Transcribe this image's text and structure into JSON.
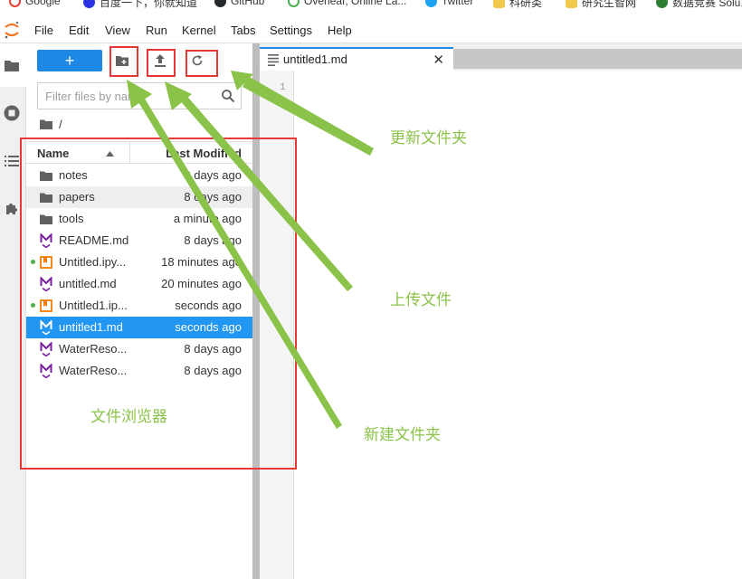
{
  "bookmarks": [
    {
      "label": "Google",
      "color": "#ea4335"
    },
    {
      "label": "百度一下，你就知道",
      "color": "#2932e1"
    },
    {
      "label": "GitHub",
      "color": "#24292e"
    },
    {
      "label": "Overleaf, Online La...",
      "color": "#4caf50"
    },
    {
      "label": "Twitter",
      "color": "#1da1f2"
    },
    {
      "label": "科研类",
      "color": "#f2c94c"
    },
    {
      "label": "研究生智网",
      "color": "#f2c94c"
    },
    {
      "label": "数据竞赛 Solu...",
      "color": "#2e7d32"
    }
  ],
  "menu": [
    "File",
    "Edit",
    "View",
    "Run",
    "Kernel",
    "Tabs",
    "Settings",
    "Help"
  ],
  "filebrowser": {
    "new_label": "+",
    "filter_placeholder": "Filter files by name",
    "breadcrumb": "/",
    "col_name": "Name",
    "col_modified": "Last Modified",
    "files": [
      {
        "name": "notes",
        "modified": "8 days ago",
        "type": "folder",
        "state": "",
        "running": false
      },
      {
        "name": "papers",
        "modified": "8 days ago",
        "type": "folder",
        "state": "hover",
        "running": false
      },
      {
        "name": "tools",
        "modified": "a minute ago",
        "type": "folder",
        "state": "",
        "running": false
      },
      {
        "name": "README.md",
        "modified": "8 days ago",
        "type": "markdown",
        "state": "",
        "running": false
      },
      {
        "name": "Untitled.ipy...",
        "modified": "18 minutes ago",
        "type": "notebook",
        "state": "",
        "running": true
      },
      {
        "name": "untitled.md",
        "modified": "20 minutes ago",
        "type": "markdown",
        "state": "",
        "running": false
      },
      {
        "name": "Untitled1.ip...",
        "modified": "seconds ago",
        "type": "notebook",
        "state": "",
        "running": true
      },
      {
        "name": "untitled1.md",
        "modified": "seconds ago",
        "type": "markdown",
        "state": "selected",
        "running": false
      },
      {
        "name": "WaterReso...",
        "modified": "8 days ago",
        "type": "markdown",
        "state": "",
        "running": false
      },
      {
        "name": "WaterReso...",
        "modified": "8 days ago",
        "type": "markdown",
        "state": "",
        "running": false
      }
    ]
  },
  "editor": {
    "tab_label": "untitled1.md",
    "tab_close": "✕",
    "line_number": "1"
  },
  "annotations": {
    "refresh": "更新文件夹",
    "upload": "上传文件",
    "new_folder": "新建文件夹",
    "file_browser": "文件浏览器"
  },
  "colors": {
    "accent": "#1e88e5",
    "selected_row": "#2196f3",
    "annotation_box": "#e53935",
    "annotation_text": "#8bc34a",
    "markdown_icon": "#7b1fa2",
    "notebook_icon": "#f57c00",
    "running_dot": "#4caf50"
  }
}
